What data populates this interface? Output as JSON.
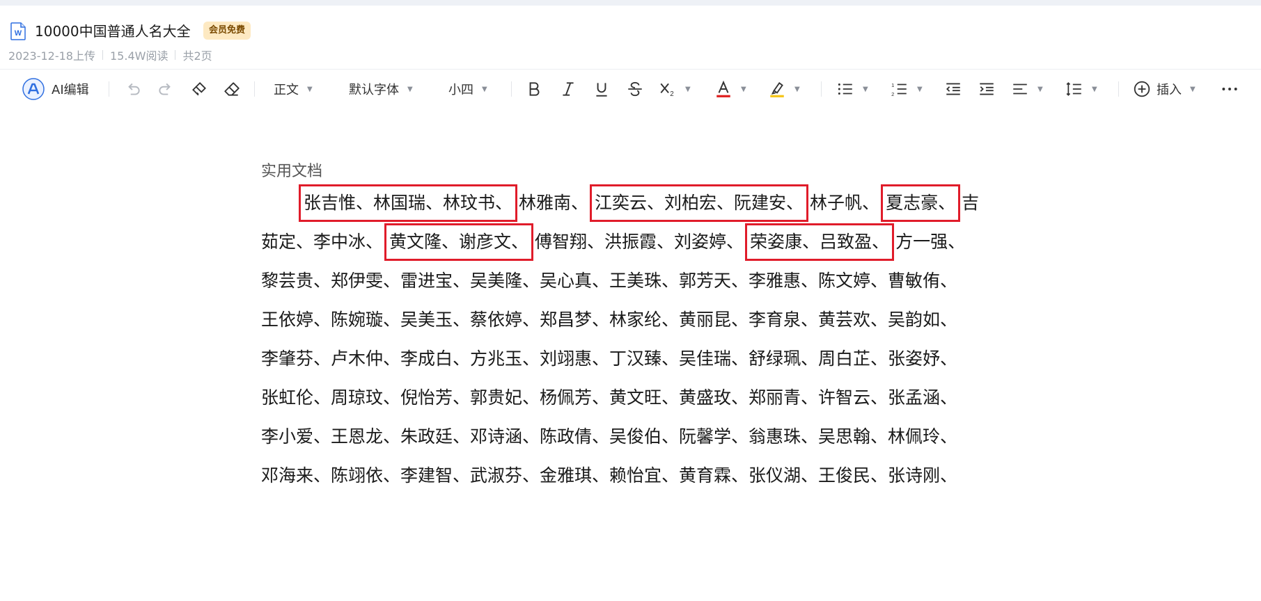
{
  "header": {
    "title": "10000中国普通人名大全",
    "badge": "会员免费",
    "upload_date": "2023-12-18上传",
    "reads": "15.4W阅读",
    "pages": "共2页",
    "doc_icon_letter": "W"
  },
  "toolbar": {
    "ai_label": "AI编辑",
    "style_label": "正文",
    "font_label": "默认字体",
    "size_label": "小四",
    "insert_label": "插入",
    "icons": [
      "undo-icon",
      "redo-icon",
      "format-painter-icon",
      "eraser-icon",
      "bold-icon",
      "italic-icon",
      "underline-icon",
      "strikethrough-icon",
      "subscript-icon",
      "font-color-icon",
      "highlight-icon",
      "bullet-list-icon",
      "numbered-list-icon",
      "outdent-icon",
      "indent-icon",
      "align-icon",
      "line-spacing-icon",
      "insert-icon",
      "more-icon"
    ],
    "colors": {
      "font_color": "#e02020",
      "highlight": "#f5c518"
    }
  },
  "document": {
    "page_header": "实用文档",
    "highlight_color": "#e01c2a",
    "lines": [
      {
        "indent": true,
        "segments": [
          {
            "text": "张吉惟、林国瑞、林玟书、",
            "hl": true
          },
          {
            "text": "林雅南、",
            "hl": false
          },
          {
            "text": "江奕云、刘柏宏、阮建安、",
            "hl": true
          },
          {
            "text": "林子帆、",
            "hl": false
          },
          {
            "text": "夏志豪、",
            "hl": true
          },
          {
            "text": "吉",
            "hl": false
          }
        ]
      },
      {
        "indent": false,
        "segments": [
          {
            "text": "茹定、李中冰、",
            "hl": false
          },
          {
            "text": "黄文隆、谢彦文、",
            "hl": true
          },
          {
            "text": "傅智翔、洪振霞、刘姿婷、",
            "hl": false
          },
          {
            "text": "荣姿康、吕致盈、",
            "hl": true
          },
          {
            "text": "方一强、",
            "hl": false
          }
        ]
      },
      {
        "indent": false,
        "segments": [
          {
            "text": "黎芸贵、郑伊雯、雷进宝、吴美隆、吴心真、王美珠、郭芳天、李雅惠、陈文婷、曹敏侑、",
            "hl": false
          }
        ]
      },
      {
        "indent": false,
        "segments": [
          {
            "text": "王依婷、陈婉璇、吴美玉、蔡依婷、郑昌梦、林家纶、黄丽昆、李育泉、黄芸欢、吴韵如、",
            "hl": false
          }
        ]
      },
      {
        "indent": false,
        "segments": [
          {
            "text": "李肇芬、卢木仲、李成白、方兆玉、刘翊惠、丁汉臻、吴佳瑞、舒绿珮、周白芷、张姿妤、",
            "hl": false
          }
        ]
      },
      {
        "indent": false,
        "segments": [
          {
            "text": "张虹伦、周琼玟、倪怡芳、郭贵妃、杨佩芳、黄文旺、黄盛玫、郑丽青、许智云、张孟涵、",
            "hl": false
          }
        ]
      },
      {
        "indent": false,
        "segments": [
          {
            "text": "李小爱、王恩龙、朱政廷、邓诗涵、陈政倩、吴俊伯、阮馨学、翁惠珠、吴思翰、林佩玲、",
            "hl": false
          }
        ]
      },
      {
        "indent": false,
        "segments": [
          {
            "text": "邓海来、陈翊依、李建智、武淑芬、金雅琪、赖怡宜、黄育霖、张仪湖、王俊民、张诗刚、",
            "hl": false
          }
        ]
      }
    ]
  }
}
